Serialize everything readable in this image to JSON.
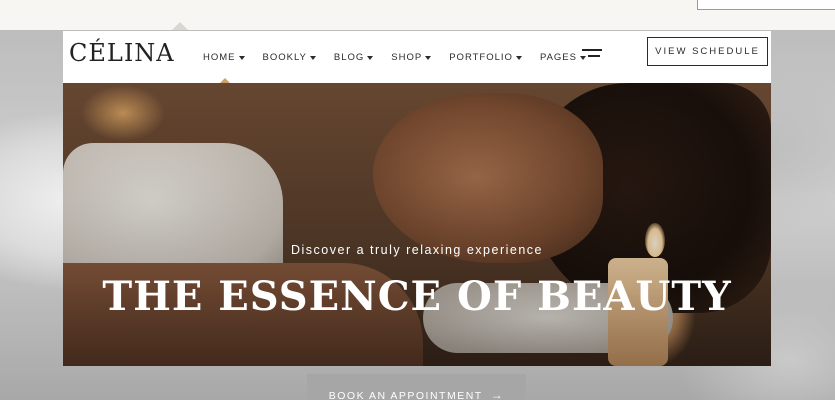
{
  "brand": {
    "logo": "CÉLINA"
  },
  "nav": {
    "items": [
      {
        "label": "HOME"
      },
      {
        "label": "BOOKLY"
      },
      {
        "label": "BLOG"
      },
      {
        "label": "SHOP"
      },
      {
        "label": "PORTFOLIO"
      },
      {
        "label": "PAGES"
      }
    ],
    "cta": "VIEW SCHEDULE"
  },
  "hero": {
    "subtitle": "Discover a truly relaxing experience",
    "title": "THE ESSENCE OF BEAUTY"
  },
  "booking": {
    "label": "BOOK AN APPOINTMENT",
    "arrow": "→"
  },
  "colors": {
    "accent": "#c9a36a",
    "button_gray": "#a6a6a6",
    "text_dark": "#2b2b2b"
  }
}
